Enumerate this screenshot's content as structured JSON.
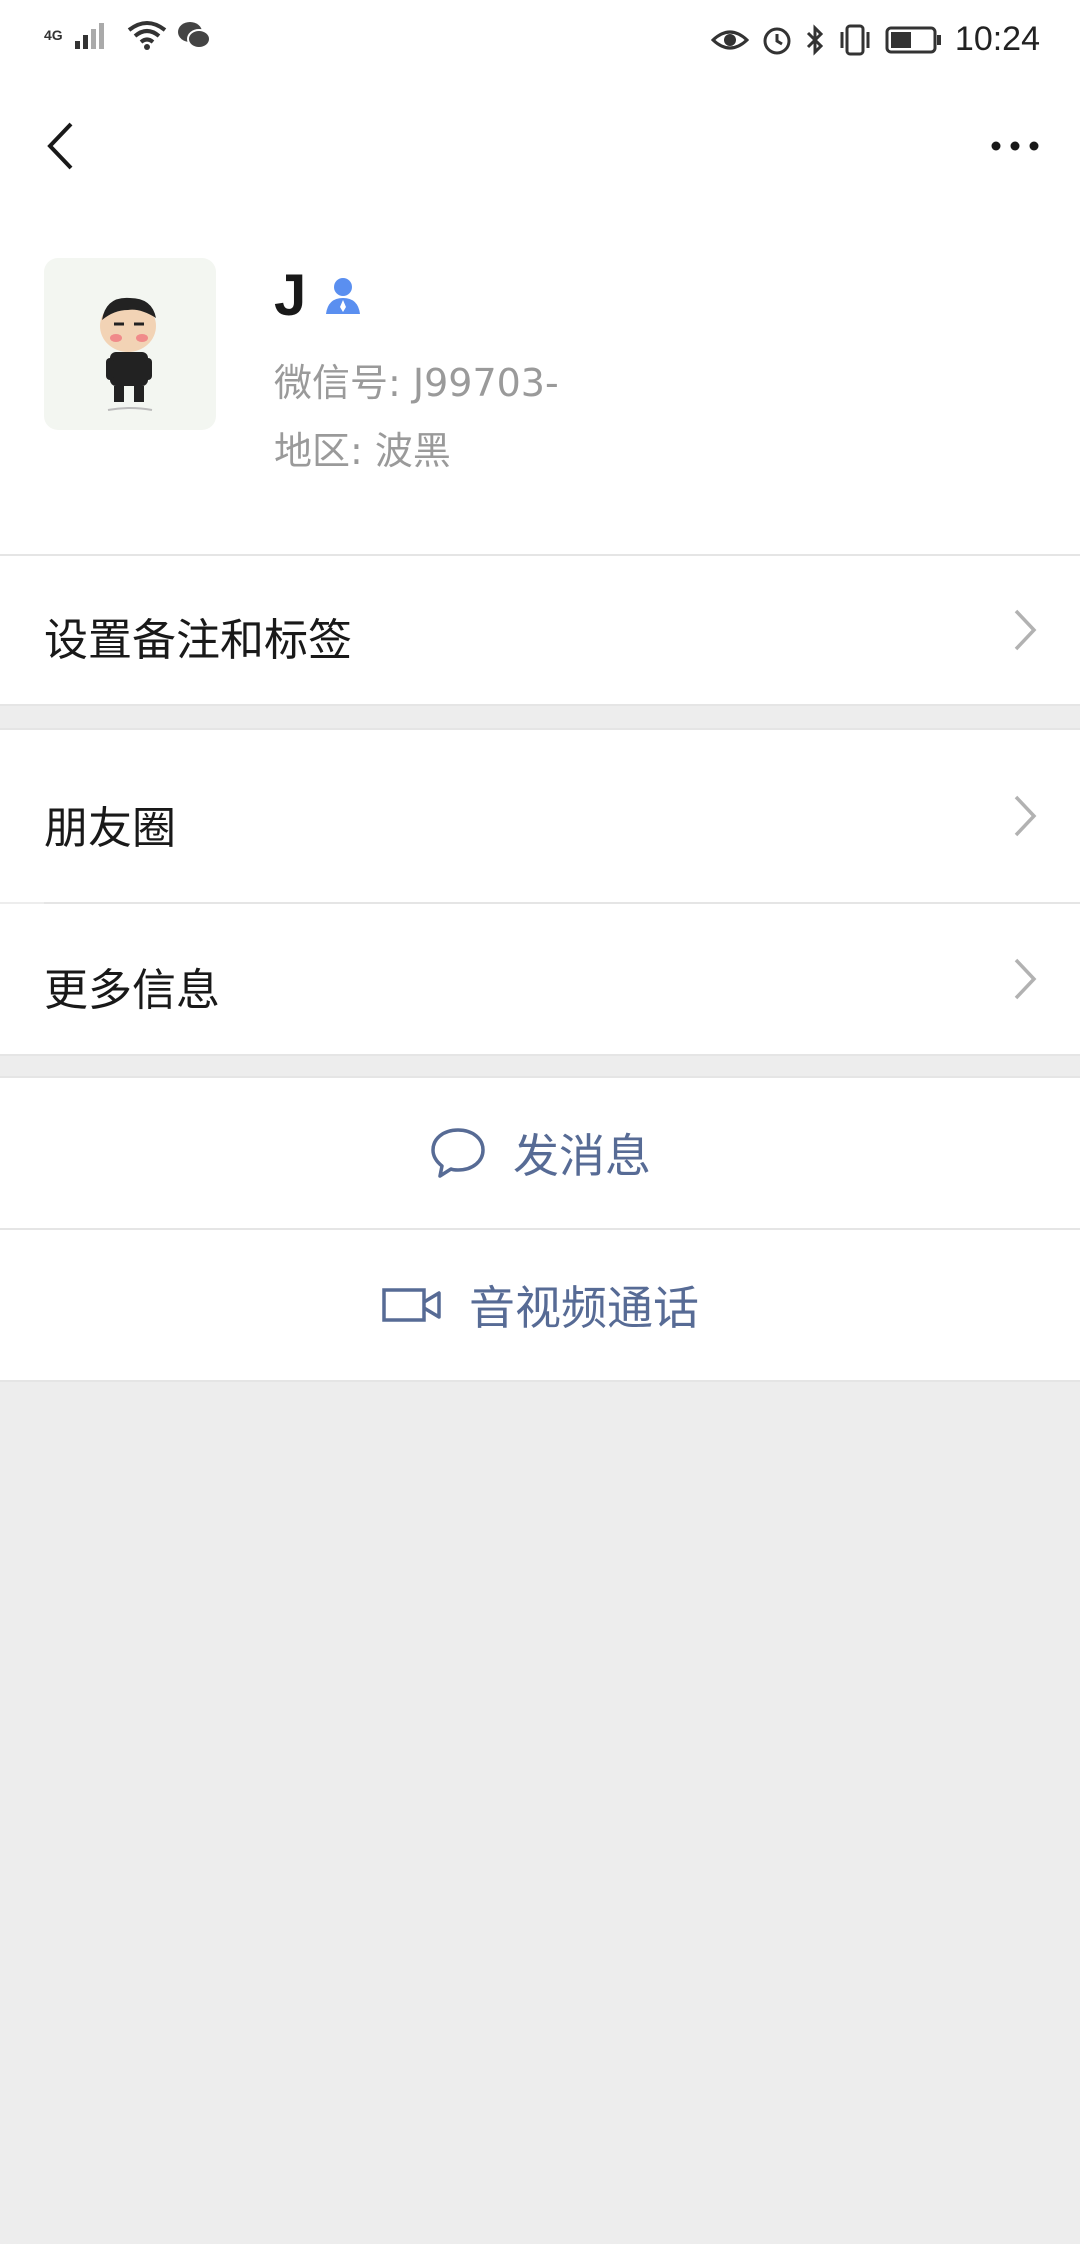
{
  "status_bar": {
    "network": "4G",
    "time": "10:24"
  },
  "profile": {
    "name": "J",
    "wechat_id": "微信号: J99703-",
    "region": "地区: 波黑"
  },
  "cells": {
    "remark_tags": "设置备注和标签",
    "moments": "朋友圈",
    "more_info": "更多信息"
  },
  "actions": {
    "send_message": "发消息",
    "av_call": "音视频通话"
  },
  "colors": {
    "link_blue": "#576b95",
    "contact_icon_blue": "#5a8ff0",
    "page_gray": "#ededed"
  },
  "icons": [
    "back-icon",
    "more-icon",
    "contact-icon",
    "chevron-right-icon",
    "chat-bubble-icon",
    "video-camera-icon"
  ]
}
